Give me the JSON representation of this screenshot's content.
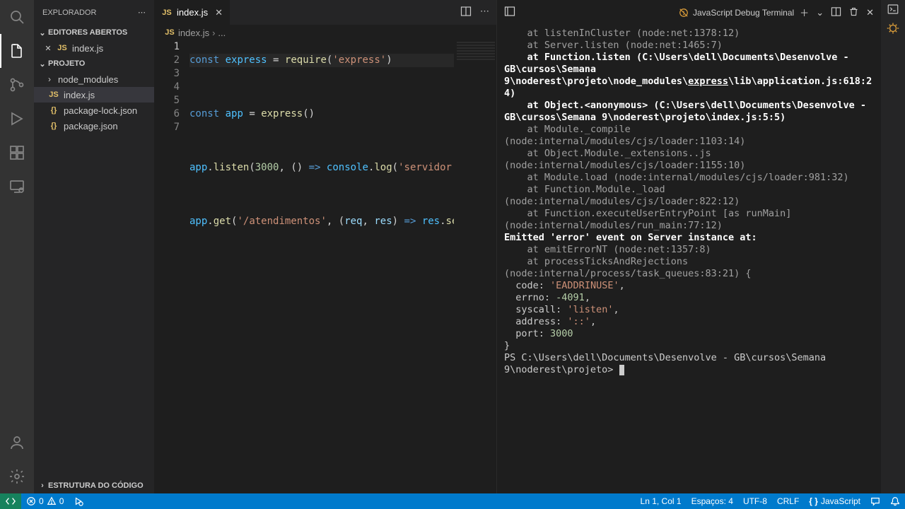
{
  "sidebar": {
    "title": "EXPLORADOR",
    "open_editors_label": "EDITORES ABERTOS",
    "project_label": "PROJETO",
    "outline_label": "ESTRUTURA DO CÓDIGO",
    "open_editors": [
      {
        "name": "index.js",
        "icon": "JS"
      }
    ],
    "files": [
      {
        "name": "node_modules",
        "type": "folder"
      },
      {
        "name": "index.js",
        "type": "js",
        "selected": true
      },
      {
        "name": "package-lock.json",
        "type": "json"
      },
      {
        "name": "package.json",
        "type": "json"
      }
    ]
  },
  "tab": {
    "name": "index.js"
  },
  "breadcrumb": {
    "file": "index.js",
    "rest": "..."
  },
  "code": {
    "l1": {
      "kw1": "const",
      "v1": "express",
      "op": " = ",
      "fn": "require",
      "p1": "(",
      "str": "'express'",
      "p2": ")"
    },
    "l3": {
      "kw1": "const",
      "v1": "app",
      "op": " = ",
      "fn": "express",
      "p1": "(",
      "p2": ")"
    },
    "l5": {
      "v1": "app",
      "dot": ".",
      "fn": "listen",
      "p1": "(",
      "num": "3000",
      "c": ", ",
      "ar": "() ",
      "arrow": "=>",
      "sp": " ",
      "v2": "console",
      "dot2": ".",
      "fn2": "log",
      "p3": "(",
      "str": "'servidor roda"
    },
    "l7": {
      "v1": "app",
      "dot": ".",
      "fn": "get",
      "p1": "(",
      "str": "'/atendimentos'",
      "c": ", (",
      "par1": "req",
      "c2": ", ",
      "par2": "res",
      "p2": ") ",
      "arrow": "=>",
      "sp": " ",
      "v2": "res",
      "dot2": ".",
      "fn2": "send",
      "p3": "(",
      "str2": "'"
    }
  },
  "terminal": {
    "name": "JavaScript Debug Terminal",
    "lines": {
      "l0": "    at listenInCluster (node:net:1378:12)",
      "l1": "    at Server.listen (node:net:1465:7)",
      "l2a": "    at Function.listen (C:\\Users\\dell\\Documents\\Desenvolve - GB\\cursos\\Semana 9\\noderest\\projeto\\node_modules\\",
      "l2u": "express",
      "l2b": "\\lib\\application.js:618:24)",
      "l3": "    at Object.<anonymous> (C:\\Users\\dell\\Documents\\Desenvolve - GB\\cursos\\Semana 9\\noderest\\projeto\\index.js:5:5)",
      "l4": "    at Module._compile (node:internal/modules/cjs/loader:1103:14)",
      "l5": "    at Object.Module._extensions..js (node:internal/modules/cjs/loader:1155:10)",
      "l6": "    at Module.load (node:internal/modules/cjs/loader:981:32)",
      "l7": "    at Function.Module._load (node:internal/modules/cjs/loader:822:12)",
      "l8": "    at Function.executeUserEntryPoint [as runMain] (node:internal/modules/run_main:77:12)",
      "emit": "Emitted 'error' event on Server instance at:",
      "l9": "    at emitErrorNT (node:net:1357:8)",
      "l10": "    at processTicksAndRejections (node:internal/process/task_queues:83:21) {",
      "code_k": "  code: ",
      "code_v": "'EADDRINUSE'",
      "comma": ",",
      "errno_k": "  errno: ",
      "errno_v": "-4091",
      "syscall_k": "  syscall: ",
      "syscall_v": "'listen'",
      "address_k": "  address: ",
      "address_v": "'::'",
      "port_k": "  port: ",
      "port_v": "3000",
      "close": "}",
      "prompt": "PS C:\\Users\\dell\\Documents\\Desenvolve - GB\\cursos\\Semana 9\\noderest\\projeto> "
    }
  },
  "status": {
    "errors": "0",
    "warnings": "0",
    "ln_col": "Ln 1, Col 1",
    "spaces": "Espaços: 4",
    "encoding": "UTF-8",
    "eol": "CRLF",
    "lang": "JavaScript"
  }
}
